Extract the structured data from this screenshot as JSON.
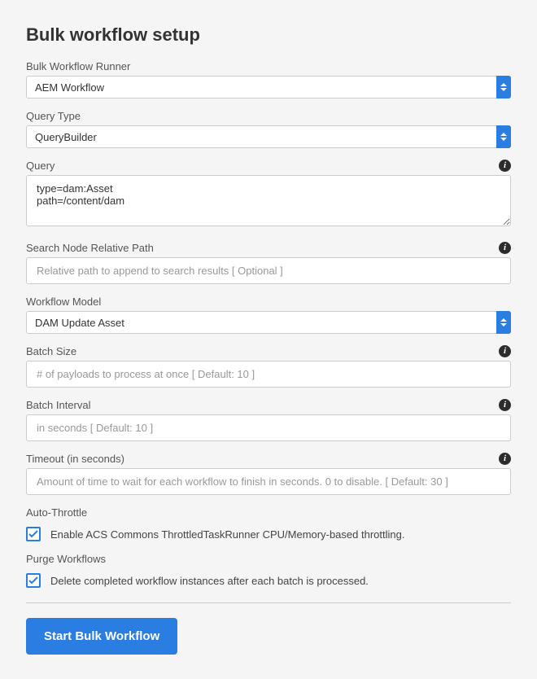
{
  "title": "Bulk workflow setup",
  "fields": {
    "runner": {
      "label": "Bulk Workflow Runner",
      "value": "AEM Workflow"
    },
    "queryType": {
      "label": "Query Type",
      "value": "QueryBuilder"
    },
    "query": {
      "label": "Query",
      "value": "type=dam:Asset\npath=/content/dam"
    },
    "relativePath": {
      "label": "Search Node Relative Path",
      "placeholder": "Relative path to append to search results [ Optional ]"
    },
    "workflowModel": {
      "label": "Workflow Model",
      "value": "DAM Update Asset"
    },
    "batchSize": {
      "label": "Batch Size",
      "placeholder": "# of payloads to process at once [ Default: 10 ]"
    },
    "batchInterval": {
      "label": "Batch Interval",
      "placeholder": "in seconds [ Default: 10 ]"
    },
    "timeout": {
      "label": "Timeout (in seconds)",
      "placeholder": "Amount of time to wait for each workflow to finish in seconds. 0 to disable. [ Default: 30 ]"
    },
    "autoThrottle": {
      "label": "Auto-Throttle",
      "checkboxLabel": "Enable ACS Commons ThrottledTaskRunner CPU/Memory-based throttling.",
      "checked": true
    },
    "purge": {
      "label": "Purge Workflows",
      "checkboxLabel": "Delete completed workflow instances after each batch is processed.",
      "checked": true
    }
  },
  "submitLabel": "Start Bulk Workflow"
}
